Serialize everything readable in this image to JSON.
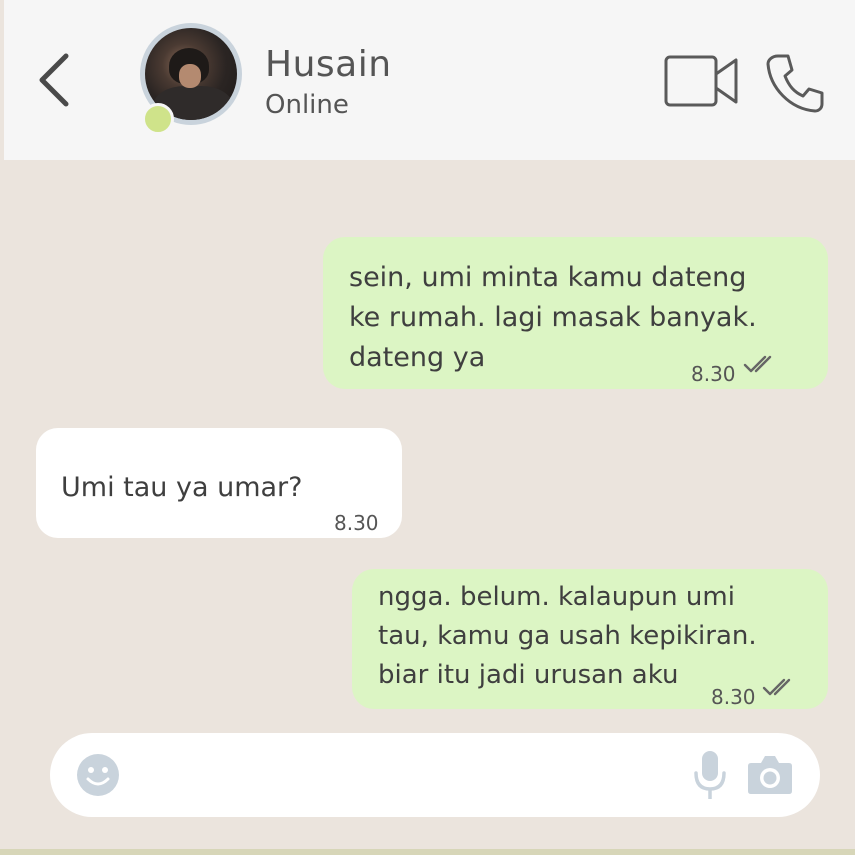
{
  "header": {
    "contact_name": "Husain",
    "contact_status": "Online",
    "status_color": "#cfe38a",
    "icons": [
      "back-arrow-icon",
      "video-call-icon",
      "phone-call-icon"
    ]
  },
  "messages": [
    {
      "direction": "outgoing",
      "text": "sein, umi minta kamu dateng\nke rumah. lagi masak banyak.\ndateng ya",
      "time": "8.30",
      "read": true
    },
    {
      "direction": "incoming",
      "text": "Umi tau ya umar?",
      "time": "8.30"
    },
    {
      "direction": "outgoing",
      "text": "ngga.  belum.  kalaupun  umi\ntau, kamu ga usah kepikiran.\nbiar itu jadi urusan aku",
      "time": "8.30",
      "read": true
    }
  ],
  "composer": {
    "value": "",
    "icons": [
      "emoji-icon",
      "microphone-icon",
      "camera-icon"
    ]
  },
  "colors": {
    "chat_background": "#ebe4dd",
    "outgoing_bubble": "#dcf5c4",
    "incoming_bubble": "#ffffff",
    "header_background": "#f6f6f6"
  }
}
